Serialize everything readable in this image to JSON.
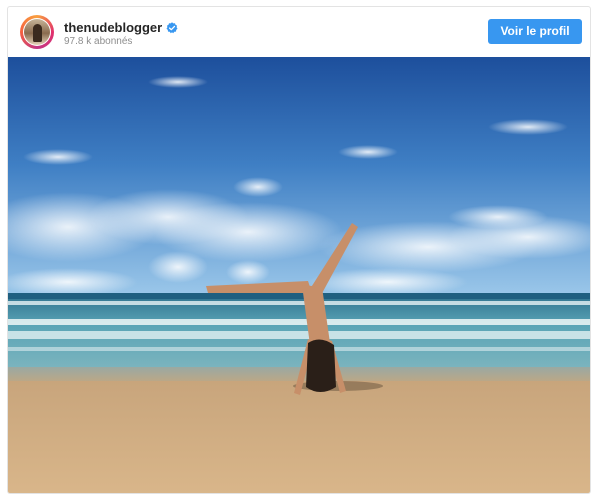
{
  "post": {
    "username": "thenudeblogger",
    "followers": "97.8 k abonnés",
    "verified": true,
    "profile_button": "Voir le profil"
  },
  "icons": {
    "verified": "verified-badge-icon",
    "avatar": "avatar-image"
  },
  "colors": {
    "button_bg": "#3897f0",
    "verified_blue": "#3897f0",
    "sky_top": "#1d4f9c",
    "sky_bottom": "#8fc1e6",
    "sea": "#3e8ea6",
    "sand": "#cfa97a"
  },
  "photo": {
    "subject": "beach-handstand-photo"
  }
}
